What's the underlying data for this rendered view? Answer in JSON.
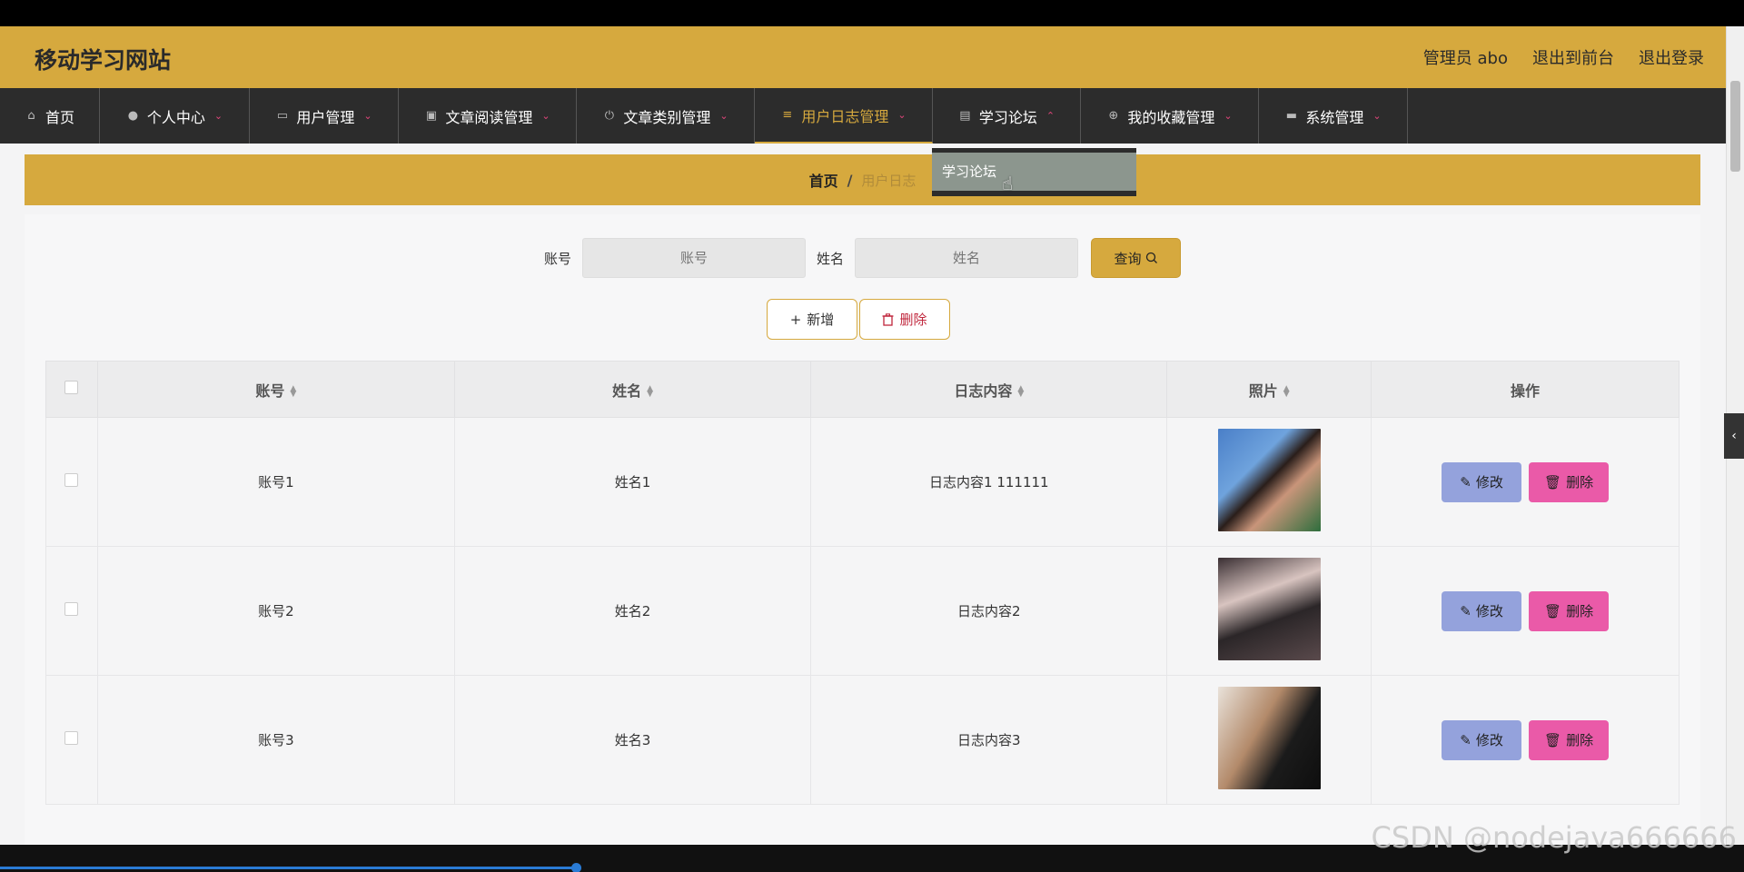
{
  "header": {
    "site_title": "移动学习网站",
    "admin_label": "管理员 abo",
    "to_front_label": "退出到前台",
    "logout_label": "退出登录"
  },
  "nav": {
    "items": [
      {
        "label": "首页",
        "icon": "home-icon",
        "caret": false
      },
      {
        "label": "个人中心",
        "icon": "user-icon",
        "caret": true
      },
      {
        "label": "用户管理",
        "icon": "id-card-icon",
        "caret": true
      },
      {
        "label": "文章阅读管理",
        "icon": "clipboard-icon",
        "caret": true
      },
      {
        "label": "文章类别管理",
        "icon": "power-icon",
        "caret": true
      },
      {
        "label": "用户日志管理",
        "icon": "list-icon",
        "caret": true,
        "active": true
      },
      {
        "label": "学习论坛",
        "icon": "chat-icon",
        "caret": true,
        "open": true
      },
      {
        "label": "我的收藏管理",
        "icon": "crosshair-icon",
        "caret": true
      },
      {
        "label": "系统管理",
        "icon": "monitor-icon",
        "caret": true
      }
    ]
  },
  "dropdown": {
    "items": [
      "学习论坛"
    ]
  },
  "breadcrumb": {
    "home": "首页",
    "separator": "/",
    "current": "用户日志"
  },
  "search": {
    "account_label": "账号",
    "account_placeholder": "账号",
    "name_label": "姓名",
    "name_placeholder": "姓名",
    "query_label": "查询"
  },
  "actions": {
    "add_label": "新增",
    "delete_label": "删除"
  },
  "table": {
    "columns": [
      "账号",
      "姓名",
      "日志内容",
      "照片",
      "操作"
    ],
    "rows": [
      {
        "account": "账号1",
        "name": "姓名1",
        "content": "日志内容1 111111"
      },
      {
        "account": "账号2",
        "name": "姓名2",
        "content": "日志内容2"
      },
      {
        "account": "账号3",
        "name": "姓名3",
        "content": "日志内容3"
      }
    ],
    "edit_label": "修改",
    "remove_label": "删除"
  },
  "watermark": "CSDN @nodejava666666",
  "colors": {
    "accent": "#d6a93e",
    "nav_bg": "#2c2c2c",
    "edit_btn": "#94a2dc",
    "delete_btn": "#ea5aa8"
  }
}
